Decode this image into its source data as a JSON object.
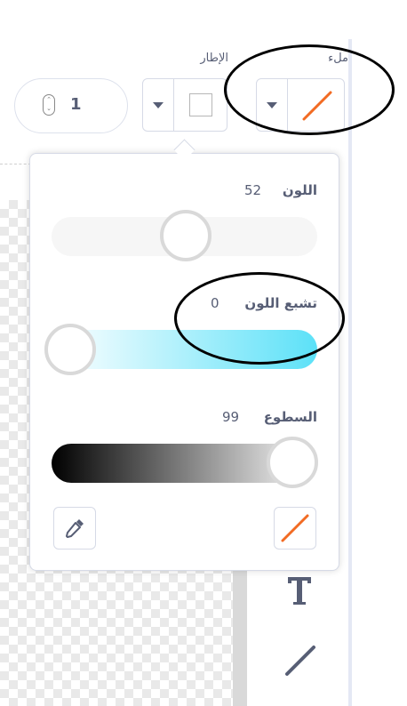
{
  "toolbar": {
    "fill_label": "ملء",
    "outline_label": "الإطار",
    "stroke_width_value": "1",
    "fill_color": "#f26b23",
    "outline_color": "none"
  },
  "color_picker": {
    "color": {
      "label": "اللون",
      "value": "52",
      "level": 0.52
    },
    "saturation": {
      "label": "تشبع اللون",
      "value": "0",
      "level": 0.0
    },
    "brightness": {
      "label": "السطوع",
      "value": "99",
      "level": 0.99
    },
    "saturation_gradient_end": "#5ce1f8",
    "no_color_stroke": "#f26b23"
  },
  "side_tools": {
    "text_icon": "text-tool-icon",
    "line_icon": "line-tool-icon"
  }
}
